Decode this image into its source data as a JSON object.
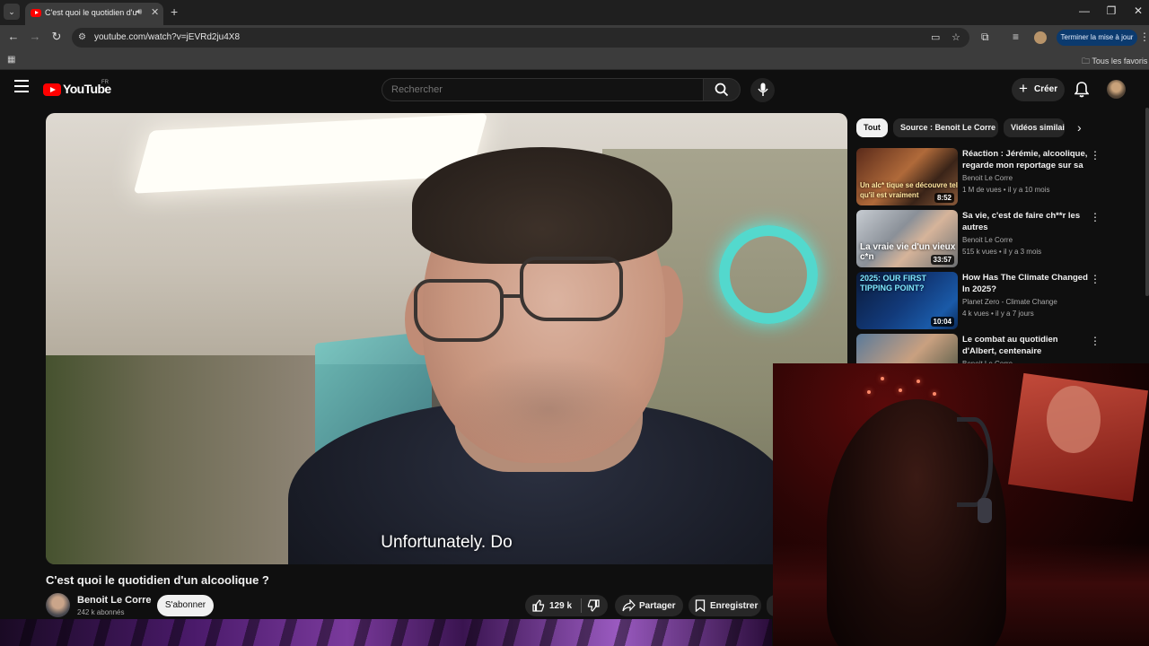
{
  "browser": {
    "tab_title": "C'est quoi le quotidien d'un alcoolique ? - YouTube",
    "url": "youtube.com/watch?v=jEVRd2ju4X8",
    "update_button": "Terminer la mise à jour",
    "bookmarks_folder": "Tous les favoris"
  },
  "header": {
    "logo_text": "YouTube",
    "country": "FR",
    "search_placeholder": "Rechercher",
    "create_label": "Créer"
  },
  "video": {
    "subtitle": "Unfortunately.  Do",
    "title": "C'est quoi le quotidien d'un alcoolique ?",
    "channel": "Benoit Le Corre",
    "subscribers": "242 k abonnés",
    "subscribe_label": "S'abonner",
    "likes": "129 k",
    "share_label": "Partager",
    "save_label": "Enregistrer"
  },
  "chips": [
    "Tout",
    "Source : Benoit Le Corre",
    "Vidéos similaires"
  ],
  "recommendations": [
    {
      "title": "Réaction : Jérémie, alcoolique, regarde mon reportage sur sa ...",
      "channel": "Benoit Le Corre",
      "meta": "1 M de vues • il y a 10 mois",
      "duration": "8:52",
      "thumb_text": "Un alc* tique se découvre tel qu'il est vraiment"
    },
    {
      "title": "Sa vie, c'est de faire ch**r les autres",
      "channel": "Benoit Le Corre",
      "meta": "515 k vues • il y a 3 mois",
      "duration": "33:57",
      "thumb_text": "La vraie vie d'un vieux c*n"
    },
    {
      "title": "How Has The Climate Changed In 2025?",
      "channel": "Planet Zero - Climate Change",
      "meta": "4 k vues • il y a 7 jours",
      "duration": "10:04",
      "thumb_text": "2025: OUR FIRST TIPPING POINT?"
    },
    {
      "title": "Le combat au quotidien d'Albert, centenaire",
      "channel": "Benoit Le Corre",
      "meta": "",
      "duration": "",
      "thumb_text": ""
    }
  ],
  "colors": {
    "youtube_red": "#ff0000",
    "background": "#0f0f0f",
    "chip_bg": "#272727",
    "update_button_bg": "#0b3a6e"
  }
}
